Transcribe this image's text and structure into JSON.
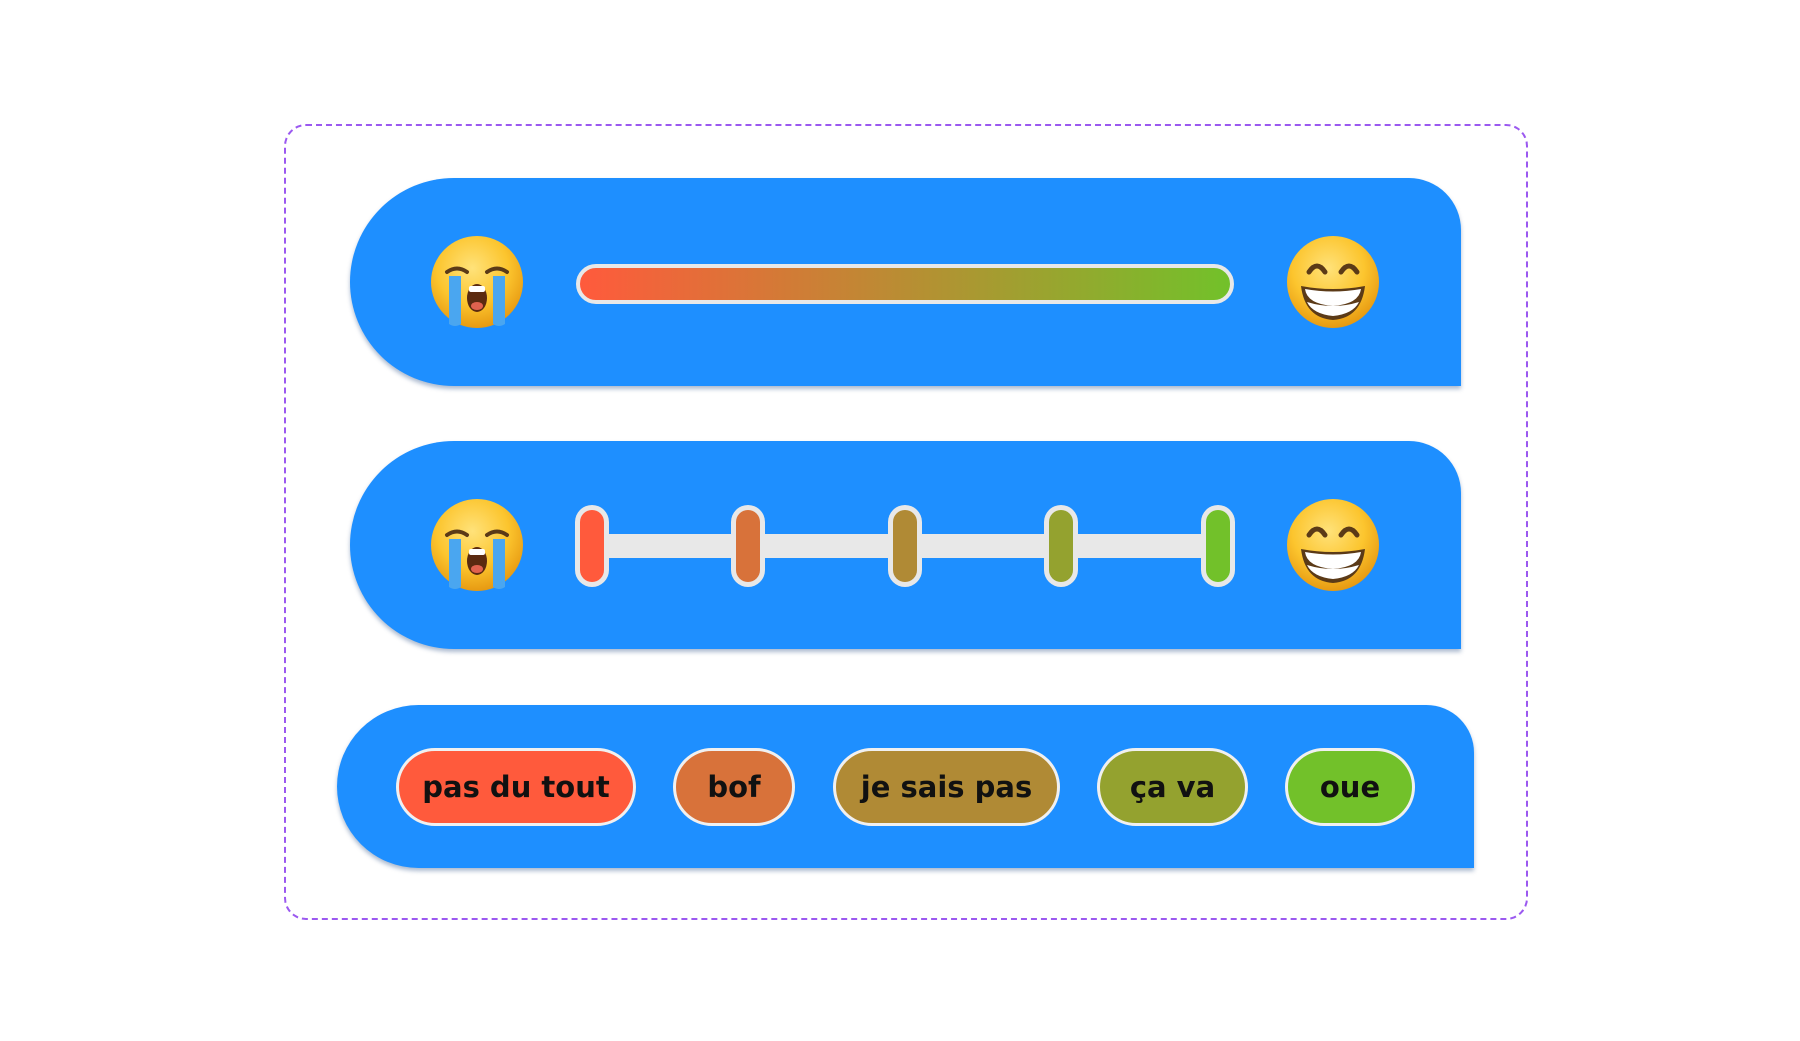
{
  "colors": {
    "panel": "#1e8fff",
    "frame_border": "#9b59f0",
    "gradient_start": "#ff5a3c",
    "gradient_end": "#72c12a",
    "track_outline": "#e8e8e8"
  },
  "slider_continuous": {
    "left_icon": "loudly-crying-face-icon",
    "right_icon": "grinning-face-with-smiling-eyes-icon"
  },
  "slider_stepped": {
    "left_icon": "loudly-crying-face-icon",
    "right_icon": "grinning-face-with-smiling-eyes-icon",
    "steps": 5
  },
  "choices": [
    {
      "label": "pas du tout",
      "color": "#ff5a3c"
    },
    {
      "label": "bof",
      "color": "#d8723a"
    },
    {
      "label": "je sais pas",
      "color": "#b08a35"
    },
    {
      "label": "ça va",
      "color": "#94a22f"
    },
    {
      "label": "oue",
      "color": "#72c12a"
    }
  ]
}
